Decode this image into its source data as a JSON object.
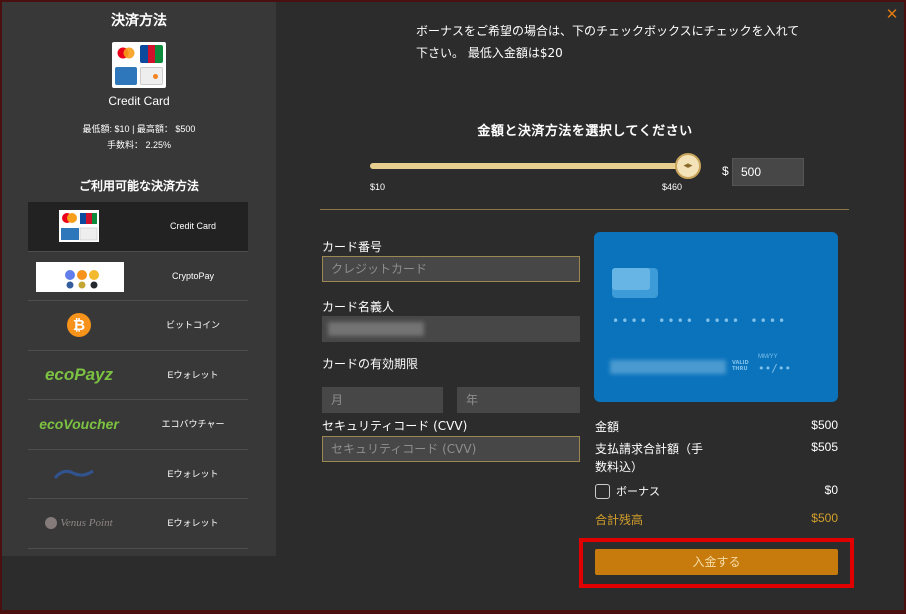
{
  "sidebar": {
    "title": "決済方法",
    "selected_method": "Credit Card",
    "limits": "最低額: $10 | 最高額： $500",
    "fee": "手数料： 2.25%",
    "available_title": "ご利用可能な決済方法",
    "methods": [
      {
        "label": "Credit Card",
        "logo": "credit-card-logos-icon",
        "active": true
      },
      {
        "label": "CryptoPay",
        "logo": "cryptopay-logo-icon",
        "active": false
      },
      {
        "label": "ビットコイン",
        "logo": "bitcoin-icon",
        "active": false
      },
      {
        "label": "Eウォレット",
        "logo": "ecopayz-logo",
        "active": false,
        "logo_text": "ecoPayz"
      },
      {
        "label": "エコバウチャー",
        "logo": "ecovoucher-logo",
        "active": false,
        "logo_text": "ecoVoucher"
      },
      {
        "label": "Eウォレット",
        "logo": "ewallet-logo-icon",
        "active": false
      },
      {
        "label": "Eウォレット",
        "logo": "venuspoint-logo",
        "active": false,
        "logo_text": "Venus Point"
      }
    ]
  },
  "header": {
    "bonus_note_line1": "ボーナスをご希望の場合は、下のチェックボックスにチェックを入れて",
    "bonus_note_line2": "下さい。 最低入金額は$20",
    "close_icon": "close-icon"
  },
  "amount": {
    "title": "金額と決済方法を選択してください",
    "slider_min_label": "$10",
    "slider_max_label": "$460",
    "slider_fraction": 1.0,
    "currency_symbol": "$",
    "value": "500"
  },
  "form": {
    "card_number_label": "カード番号",
    "card_number_placeholder": "クレジットカード",
    "cardholder_label": "カード名義人",
    "expiry_label": "カードの有効期限",
    "month_placeholder": "月",
    "year_placeholder": "年",
    "cvv_label": "セキュリティコード (CVV)",
    "cvv_placeholder": "セキュリティコード (CVV)"
  },
  "card_preview": {
    "number_mask": "•••• •••• •••• ••••",
    "valid_thru": "VALID THRU",
    "mm_yy": "MM/YY",
    "expiry_mask": "••/••"
  },
  "summary": {
    "amount_label": "金額",
    "amount_value": "$500",
    "total_charge_label_1": "支払請求合計額（手",
    "total_charge_label_2": "数料込）",
    "total_charge_value": "$505",
    "bonus_label": "ボーナス",
    "bonus_value": "$0",
    "balance_label": "合計残高",
    "balance_value": "$500"
  },
  "deposit_button": "入金する",
  "colors": {
    "accent": "#c77b0d",
    "highlight": "#e00000",
    "card": "#0a73bc"
  }
}
